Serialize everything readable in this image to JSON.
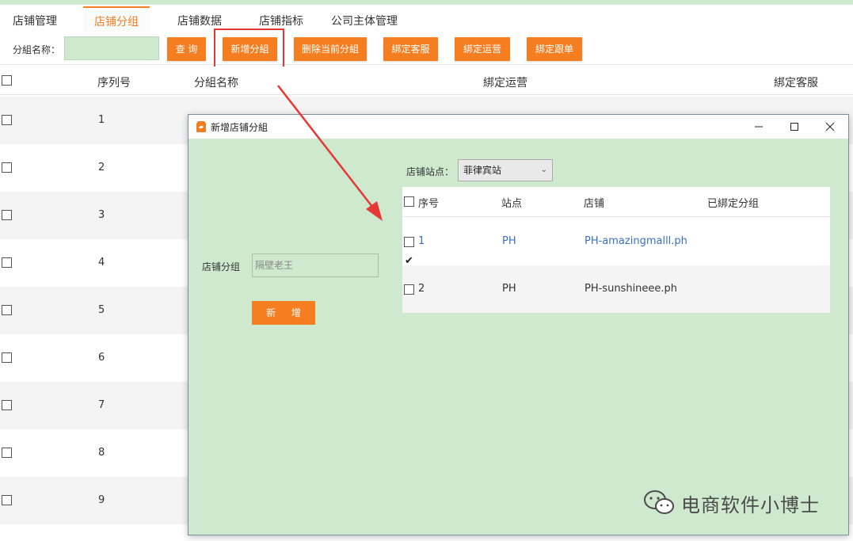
{
  "nav": {
    "tabs": [
      {
        "label": "店铺管理"
      },
      {
        "label": "店铺分组"
      },
      {
        "label": "店铺数据"
      },
      {
        "label": "店铺指标"
      },
      {
        "label": "公司主体管理"
      }
    ]
  },
  "toolbar": {
    "group_name_label": "分組名称：",
    "group_name_value": "",
    "btn_query": "查 询",
    "btn_add_group": "新增分組",
    "btn_delete_group": "删除当前分組",
    "btn_bind_cs": "綁定客服",
    "btn_bind_ops": "綁定运营",
    "btn_bind_order": "綁定跟单"
  },
  "table": {
    "columns": [
      "序列号",
      "分組名称",
      "綁定运营",
      "綁定客服"
    ],
    "rows": [
      "1",
      "2",
      "3",
      "4",
      "5",
      "6",
      "7",
      "8",
      "9"
    ]
  },
  "modal": {
    "title": "新增店铺分組",
    "group_label": "店铺分组",
    "group_input_value": "隔壁老王",
    "add_button": "新 增",
    "site_label": "店铺站点：",
    "site_selected": "菲律宾站",
    "inner_table": {
      "columns": [
        "序号",
        "站点",
        "店铺",
        "已綁定分组"
      ],
      "rows": [
        {
          "index": "1",
          "site": "PH",
          "shop": "PH-amazingmalll.ph",
          "bound": "",
          "checked": true
        },
        {
          "index": "2",
          "site": "PH",
          "shop": "PH-sunshineee.ph",
          "bound": "",
          "checked": false
        }
      ]
    }
  },
  "watermark": {
    "text": "电商软件小博士"
  },
  "colors": {
    "accent": "#f47e20",
    "highlight": "#e53935",
    "modal_bg": "#cfe9cf",
    "link_blue": "#3a6fc4"
  }
}
